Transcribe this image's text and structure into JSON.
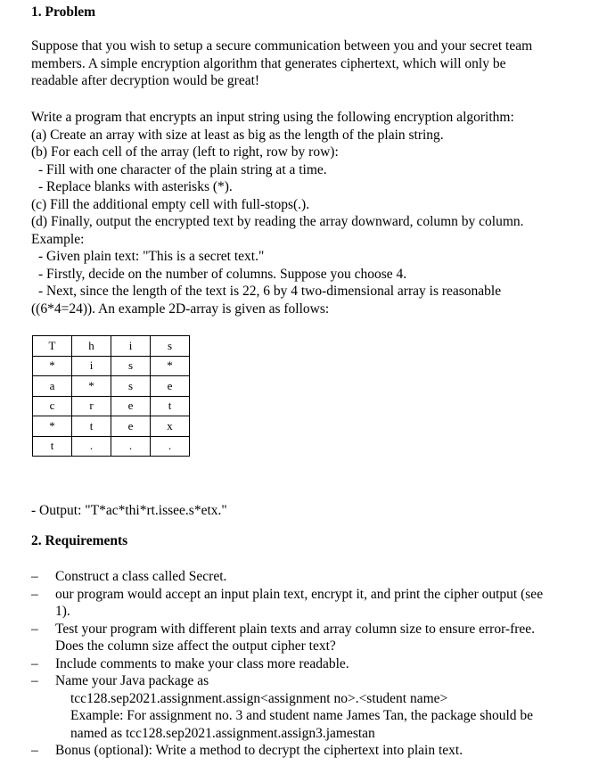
{
  "section1": {
    "heading": "1. Problem",
    "intro": [
      "Suppose that you wish to setup a secure communication between you and your secret team",
      "members. A simple encryption algorithm that generates ciphertext, which will only be",
      "readable after decryption would be great!"
    ],
    "algorithm": [
      "Write a program that encrypts an input string using the following encryption algorithm:",
      "(a) Create an array with size at least as big as the length of the plain string.",
      "(b) For each cell of the array (left to right, row by row):",
      "  - Fill with one character of the plain string at a time.",
      "  - Replace blanks with asterisks (*).",
      "(c) Fill the additional empty cell with full-stops(.).",
      "(d) Finally, output the encrypted text by reading the array downward, column by column.",
      "Example:",
      "  - Given plain text: \"This is a secret text.\"",
      "  - Firstly, decide on the number of columns. Suppose you choose 4.",
      "  - Next, since the length of the text is 22, 6 by 4 two-dimensional array is reasonable",
      "((6*4=24)). An example 2D-array is given as follows:"
    ],
    "array": [
      [
        "T",
        "h",
        "i",
        "s"
      ],
      [
        "*",
        "i",
        "s",
        "*"
      ],
      [
        "a",
        "*",
        "s",
        "e"
      ],
      [
        "c",
        "r",
        "e",
        "t"
      ],
      [
        "*",
        "t",
        "e",
        "x"
      ],
      [
        "t",
        ".",
        ".",
        "."
      ]
    ],
    "output": "  - Output: \"T*ac*thi*rt.issee.s*etx.\""
  },
  "section2": {
    "heading": "2. Requirements",
    "dash": "–",
    "items": [
      {
        "lines": [
          "Construct a class called Secret."
        ]
      },
      {
        "lines": [
          "our program would accept an input plain text, encrypt it, and print the cipher output (see",
          "1)."
        ]
      },
      {
        "lines": [
          "Test your program with different plain texts and array column size to ensure error-free.",
          "Does the column size affect the output cipher text?"
        ]
      },
      {
        "lines": [
          "Include comments to make your class more readable."
        ]
      },
      {
        "lines": [
          "Name your Java package as"
        ],
        "sub": [
          "tcc128.sep2021.assignment.assign<assignment no>.<student name>",
          "Example: For assignment no. 3 and student name James Tan, the package should be",
          "named as tcc128.sep2021.assignment.assign3.jamestan"
        ]
      },
      {
        "lines": [
          "Bonus (optional): Write a method to decrypt the ciphertext into plain text."
        ]
      }
    ]
  }
}
